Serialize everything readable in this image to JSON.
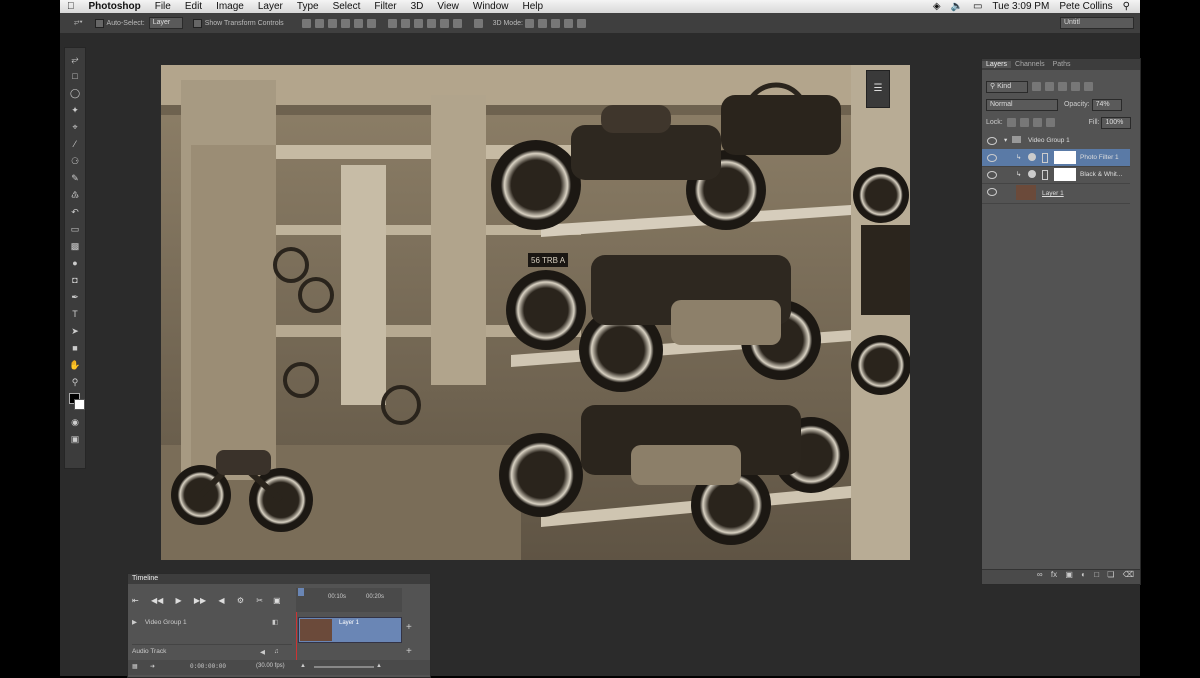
{
  "menubar": {
    "apple": "",
    "app": "Photoshop",
    "items": [
      "File",
      "Edit",
      "Image",
      "Layer",
      "Type",
      "Select",
      "Filter",
      "3D",
      "View",
      "Window",
      "Help"
    ],
    "clock": "Tue 3:09 PM",
    "user": "Pete Collins"
  },
  "options": {
    "auto_select": "Auto-Select:",
    "auto_select_value": "Layer",
    "show_transform": "Show Transform Controls",
    "mode_3d": "3D Mode:",
    "workspace": "Untitl"
  },
  "layers_panel": {
    "tabs": [
      "Layers",
      "Channels",
      "Paths"
    ],
    "kind": "Kind",
    "blend_mode": "Normal",
    "opacity_label": "Opacity:",
    "opacity_value": "74%",
    "lock_label": "Lock:",
    "fill_label": "Fill:",
    "fill_value": "100%",
    "layers": [
      {
        "name": "Video Group 1",
        "type": "group"
      },
      {
        "name": "Photo Filter 1",
        "type": "adjustment",
        "selected": true
      },
      {
        "name": "Black & Whit...",
        "type": "adjustment"
      },
      {
        "name": "Layer 1",
        "type": "image"
      }
    ]
  },
  "timeline": {
    "title": "Timeline",
    "ruler": [
      "00:10s",
      "00:20s"
    ],
    "track_group": "Video Group 1",
    "clip": "Layer 1",
    "audio_track": "Audio Track",
    "timecode": "0:00:00:00",
    "fps": "(30.00 fps)"
  },
  "colors": {
    "selected_layer": "#5a7aa6",
    "clip": "#6a86b5",
    "panel": "#535353",
    "workspace": "#2b2b2b"
  }
}
